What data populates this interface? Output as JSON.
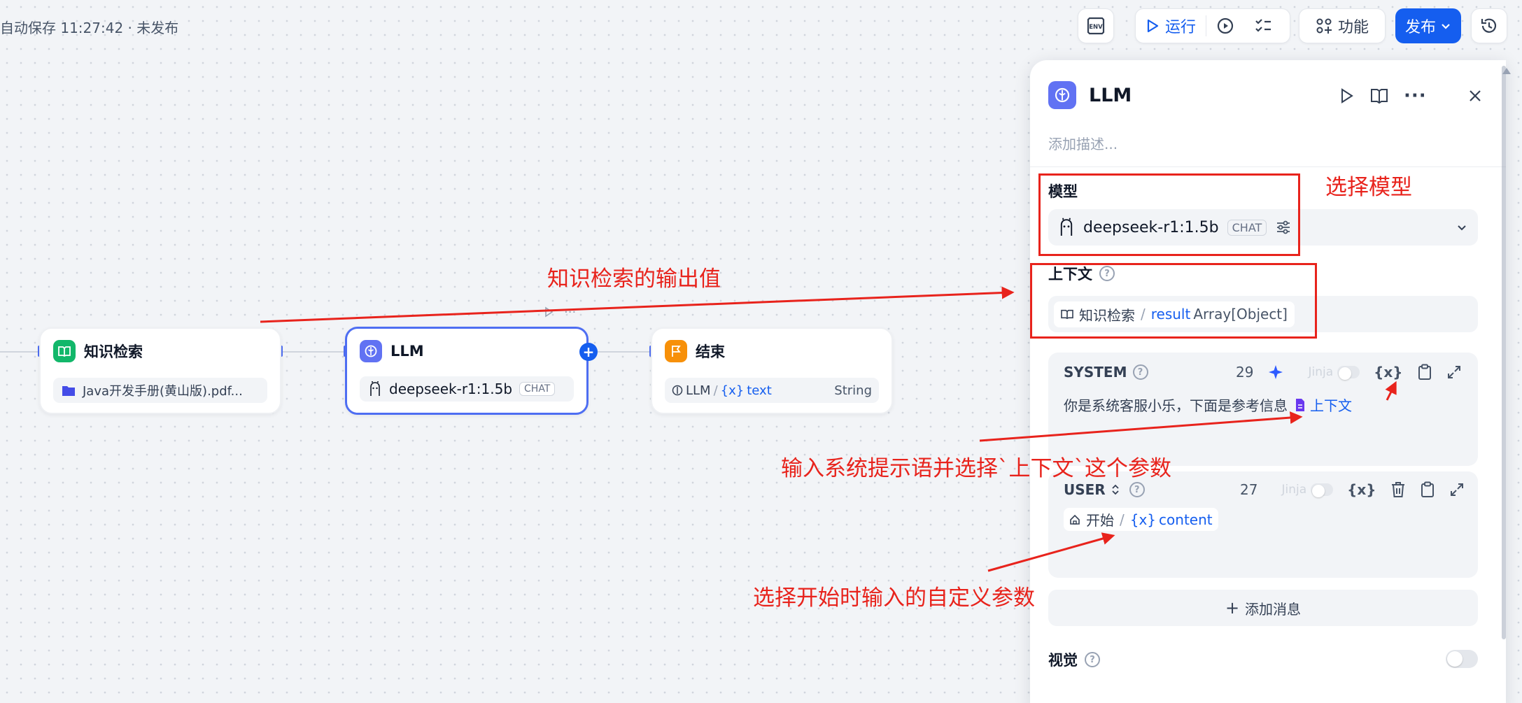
{
  "toolbar": {
    "autosave": "自动保存 11:27:42 · 未发布",
    "env_label": "ENV",
    "run_label": "运行",
    "features_label": "功能",
    "publish_label": "发布"
  },
  "nodes": {
    "knowledge": {
      "title": "知识检索",
      "file": "Java开发手册(黄山版).pdf..."
    },
    "llm": {
      "title": "LLM",
      "model": "deepseek-r1:1.5b",
      "badge": "CHAT"
    },
    "end": {
      "title": "结束",
      "var_node": "LLM",
      "var_name": "text",
      "var_type": "String"
    }
  },
  "panel": {
    "title": "LLM",
    "description_placeholder": "添加描述...",
    "model_label": "模型",
    "model_name": "deepseek-r1:1.5b",
    "model_badge": "CHAT",
    "context_label": "上下文",
    "context_node": "知识检索",
    "context_var": "result",
    "context_type": "Array[Object]",
    "system": {
      "role": "SYSTEM",
      "count": "29",
      "jinja": "Jinja",
      "text": "你是系统客服小乐，下面是参考信息",
      "chip": "上下文"
    },
    "user": {
      "role": "USER",
      "count": "27",
      "jinja": "Jinja",
      "chip_node": "开始",
      "chip_var": "content"
    },
    "add_message": "添加消息",
    "vision_label": "视觉"
  },
  "annotations": {
    "select_model": "选择模型",
    "knowledge_output": "知识检索的输出值",
    "system_prompt": "输入系统提示语并选择`上下文`这个参数",
    "start_param": "选择开始时输入的自定义参数"
  },
  "colors": {
    "accent": "#155eef",
    "annotation": "#e8231c",
    "knowledge_icon": "#12b76a",
    "llm_icon": "#6172f3",
    "end_icon": "#f79009"
  }
}
